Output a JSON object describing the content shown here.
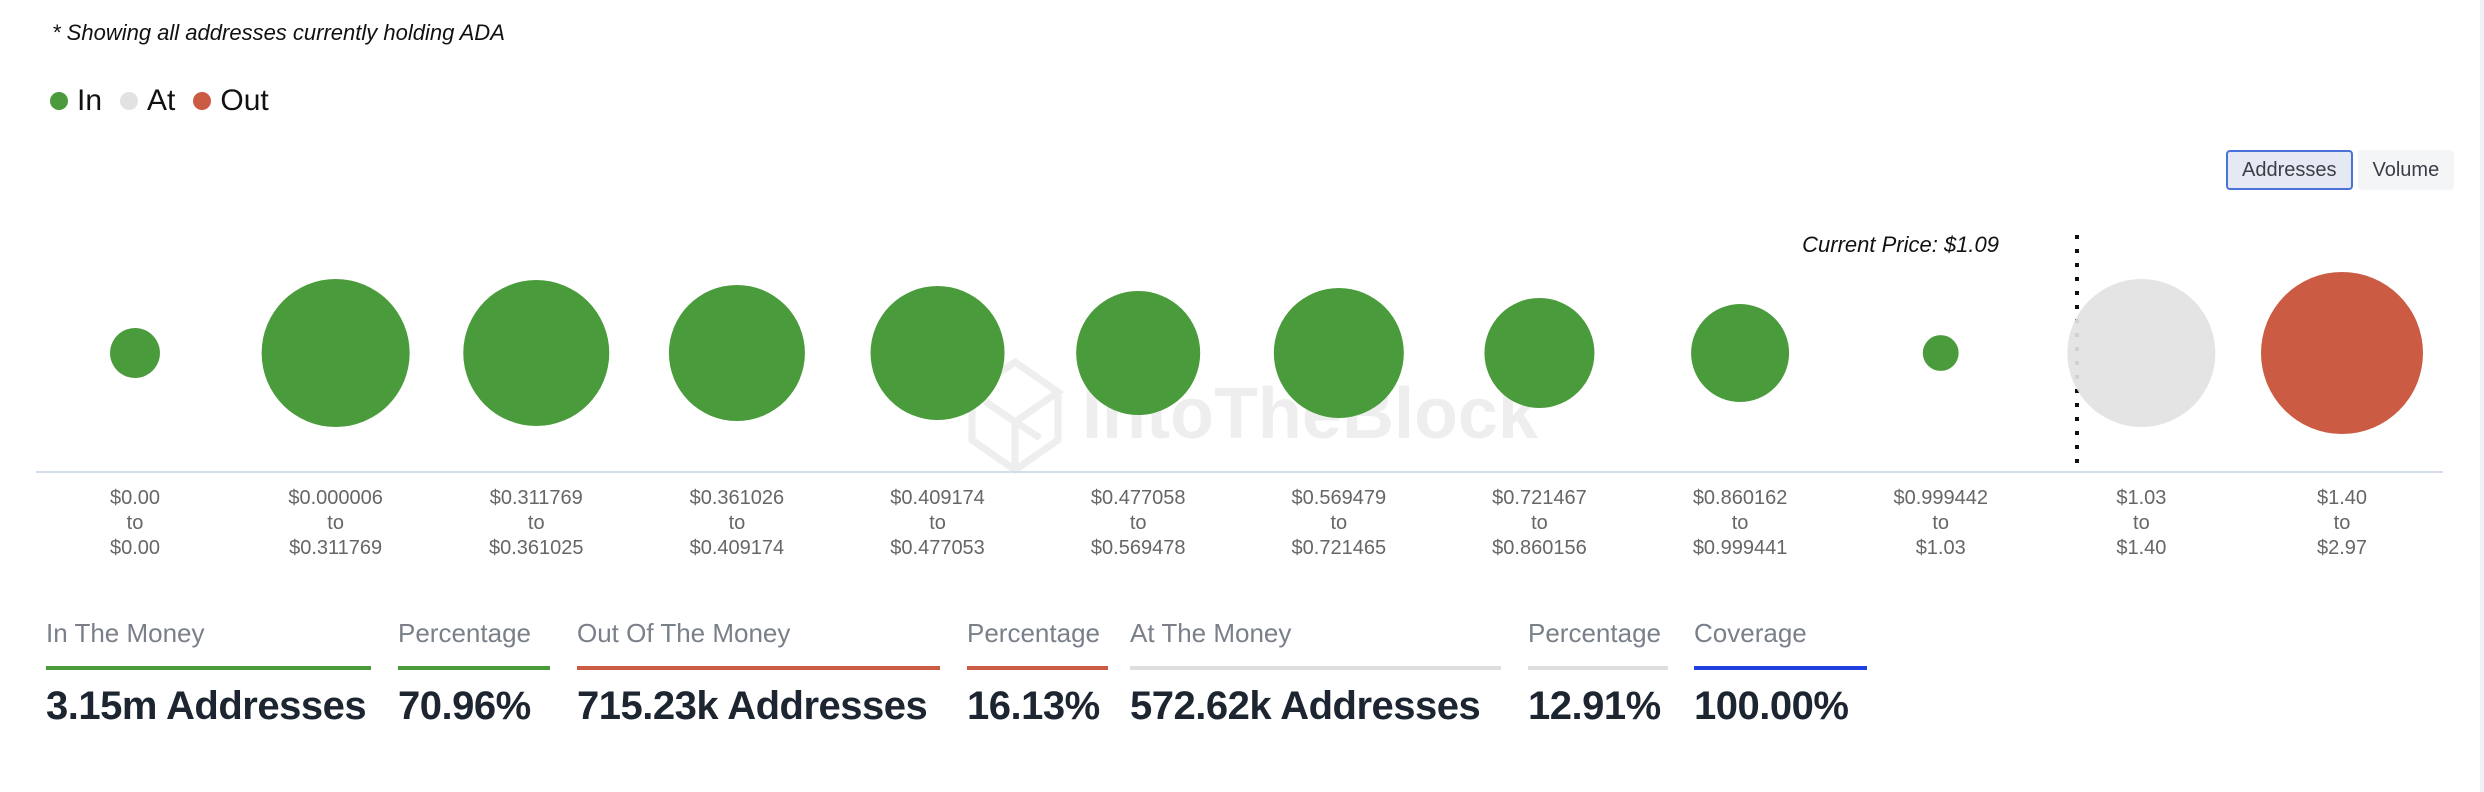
{
  "note": "* Showing all addresses currently holding ADA",
  "legend": [
    {
      "label": "In",
      "color": "#4a9b3b"
    },
    {
      "label": "At",
      "color": "#e2e2e2"
    },
    {
      "label": "Out",
      "color": "#cb5c43"
    }
  ],
  "toggle": {
    "options": [
      "Addresses",
      "Volume"
    ],
    "selected": "Addresses"
  },
  "watermark": "IntoTheBlock",
  "chart_data": {
    "type": "bubble",
    "title": "",
    "current_price_label": "Current Price: $1.09",
    "current_price": 1.09,
    "size_unit": "relative addresses (largest bubble = 100, estimated from bubble area)",
    "categories": [
      {
        "from": "$0.00",
        "to": "$0.00",
        "status": "in",
        "size": 9.5
      },
      {
        "from": "$0.000006",
        "to": "$0.311769",
        "status": "in",
        "size": 83.5
      },
      {
        "from": "$0.311769",
        "to": "$0.361025",
        "status": "in",
        "size": 81.2
      },
      {
        "from": "$0.361026",
        "to": "$0.409174",
        "status": "in",
        "size": 70.5
      },
      {
        "from": "$0.409174",
        "to": "$0.477053",
        "status": "in",
        "size": 68.4
      },
      {
        "from": "$0.477058",
        "to": "$0.569478",
        "status": "in",
        "size": 58.6
      },
      {
        "from": "$0.569479",
        "to": "$0.721465",
        "status": "in",
        "size": 64.4
      },
      {
        "from": "$0.721467",
        "to": "$0.860156",
        "status": "in",
        "size": 46.1
      },
      {
        "from": "$0.860162",
        "to": "$0.999441",
        "status": "in",
        "size": 36.6
      },
      {
        "from": "$0.999442",
        "to": "$1.03",
        "status": "in",
        "size": 4.9
      },
      {
        "from": "$1.03",
        "to": "$1.40",
        "status": "at",
        "size": 83.5
      },
      {
        "from": "$1.40",
        "to": "$2.97",
        "status": "out",
        "size": 100
      }
    ],
    "range_joiner": "to",
    "current_price_after_index": 9,
    "colors": {
      "in": "#4a9b3b",
      "at": "#e2e2e2",
      "out": "#cb5c43"
    }
  },
  "stats": [
    {
      "label": "In The Money",
      "value": "3.15m Addresses",
      "color": "#4a9b3b"
    },
    {
      "label": "Percentage",
      "value": "70.96%",
      "color": "#4a9b3b"
    },
    {
      "label": "Out Of The Money",
      "value": "715.23k Addresses",
      "color": "#cb5c43"
    },
    {
      "label": "Percentage",
      "value": "16.13%",
      "color": "#cb5c43"
    },
    {
      "label": "At The Money",
      "value": "572.62k Addresses",
      "color": "#dedede"
    },
    {
      "label": "Percentage",
      "value": "12.91%",
      "color": "#dedede"
    },
    {
      "label": "Coverage",
      "value": "100.00%",
      "color": "#1f3fe0"
    }
  ]
}
